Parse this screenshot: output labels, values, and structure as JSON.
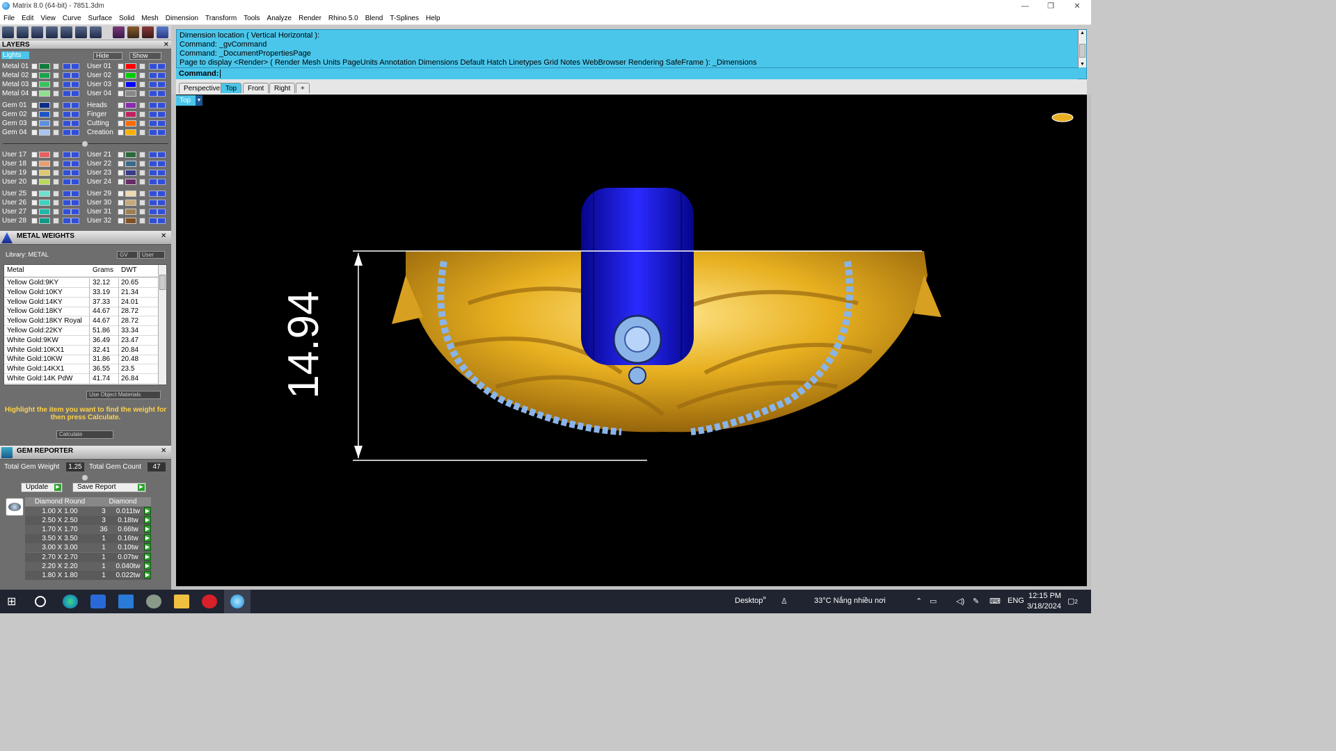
{
  "window": {
    "title": "Matrix 8.0 (64-bit) - 7851.3dm",
    "min": "—",
    "restore": "❐",
    "close": "✕"
  },
  "menu": [
    "File",
    "Edit",
    "View",
    "Curve",
    "Surface",
    "Solid",
    "Mesh",
    "Dimension",
    "Transform",
    "Tools",
    "Analyze",
    "Render",
    "Rhino 5.0",
    "Blend",
    "T-Splines",
    "Help"
  ],
  "layers": {
    "title": "LAYERS",
    "lights_label": "Lights",
    "hide_label": "Hide",
    "show_label": "Show",
    "left": [
      {
        "name": "Metal 01",
        "color": "#0f7a3a"
      },
      {
        "name": "Metal 02",
        "color": "#1aa34a"
      },
      {
        "name": "Metal 03",
        "color": "#39c35c"
      },
      {
        "name": "Metal 04",
        "color": "#8ee08e"
      },
      {
        "name": "Gem 01",
        "color": "#0a2c8c"
      },
      {
        "name": "Gem 02",
        "color": "#1c55c8"
      },
      {
        "name": "Gem 03",
        "color": "#5a8fe0"
      },
      {
        "name": "Gem 04",
        "color": "#a8c4f0"
      },
      {
        "name": "User 17",
        "color": "#e86060"
      },
      {
        "name": "User 18",
        "color": "#e8a070"
      },
      {
        "name": "User 19",
        "color": "#e0c870"
      },
      {
        "name": "User 20",
        "color": "#b8d860"
      },
      {
        "name": "User 25",
        "color": "#70e0d0"
      },
      {
        "name": "User 26",
        "color": "#40d0c0"
      },
      {
        "name": "User 27",
        "color": "#20b8a8"
      },
      {
        "name": "User 28",
        "color": "#109888"
      }
    ],
    "right": [
      {
        "name": "User 01",
        "color": "#ff0000"
      },
      {
        "name": "User 02",
        "color": "#00cc00"
      },
      {
        "name": "User 03",
        "color": "#0000ff"
      },
      {
        "name": "User 04",
        "color": "#888888"
      },
      {
        "name": "Heads",
        "color": "#8a2ab0"
      },
      {
        "name": "Finger",
        "color": "#c02060"
      },
      {
        "name": "Cutting",
        "color": "#ff6a00"
      },
      {
        "name": "Creation",
        "color": "#ffb000"
      },
      {
        "name": "User 21",
        "color": "#2a6a3a"
      },
      {
        "name": "User 22",
        "color": "#3a6a8a"
      },
      {
        "name": "User 23",
        "color": "#3a3a8a"
      },
      {
        "name": "User 24",
        "color": "#6a2a6a"
      },
      {
        "name": "User 29",
        "color": "#f0d8b0"
      },
      {
        "name": "User 30",
        "color": "#c8a878"
      },
      {
        "name": "User 31",
        "color": "#a08050"
      },
      {
        "name": "User 32",
        "color": "#805020"
      }
    ]
  },
  "metal_weights": {
    "title": "METAL WEIGHTS",
    "library": "Library: METAL",
    "gv_label": "GV",
    "user_label": "User",
    "headers": [
      "Metal",
      "Grams",
      "DWT"
    ],
    "rows": [
      [
        "Yellow Gold:9KY",
        "32.12",
        "20.65"
      ],
      [
        "Yellow Gold:10KY",
        "33.19",
        "21.34"
      ],
      [
        "Yellow Gold:14KY",
        "37.33",
        "24.01"
      ],
      [
        "Yellow Gold:18KY",
        "44.67",
        "28.72"
      ],
      [
        "Yellow Gold:18KY Royal",
        "44.67",
        "28.72"
      ],
      [
        "Yellow Gold:22KY",
        "51.86",
        "33.34"
      ],
      [
        "White Gold:9KW",
        "36.49",
        "23.47"
      ],
      [
        "White Gold:10KX1",
        "32.41",
        "20.84"
      ],
      [
        "White Gold:10KW",
        "31.86",
        "20.48"
      ],
      [
        "White Gold:14KX1",
        "36.55",
        "23.5"
      ],
      [
        "White Gold:14K PdW",
        "41.74",
        "26.84"
      ]
    ],
    "use_object_materials": "Use Object Materials",
    "hint": "Highlight the item you want to find the weight for then press Calculate.",
    "calculate": "Calculate"
  },
  "gem_reporter": {
    "title": "GEM REPORTER",
    "total_weight_label": "Total Gem Weight",
    "total_weight": "1.25",
    "total_count_label": "Total Gem Count",
    "total_count": "47",
    "update": "Update",
    "save_report": "Save Report",
    "headers": [
      "Diamond Round",
      "Diamond"
    ],
    "rows": [
      [
        "1.00 X 1.00",
        "3",
        "0.011tw"
      ],
      [
        "2.50 X 2.50",
        "3",
        "0.18tw"
      ],
      [
        "1.70 X 1.70",
        "36",
        "0.66tw"
      ],
      [
        "3.50 X 3.50",
        "1",
        "0.16tw"
      ],
      [
        "3.00 X 3.00",
        "1",
        "0.10tw"
      ],
      [
        "2.70 X 2.70",
        "1",
        "0.07tw"
      ],
      [
        "2.20 X 2.20",
        "1",
        "0.040tw"
      ],
      [
        "1.80 X 1.80",
        "1",
        "0.022tw"
      ]
    ]
  },
  "command": {
    "lines": [
      "Dimension location ( Vertical  Horizontal ):",
      "Command: _gvCommand",
      "Command: _DocumentPropertiesPage",
      "Page to display <Render> ( Render  Mesh  Units  PageUnits  Annotation  Dimensions  Default  Hatch  Linetypes  Grid  Notes  WebBrowser  Rendering  SafeFrame ): _Dimensions"
    ],
    "prompt": "Command:"
  },
  "viewport": {
    "tabs": [
      "Perspective",
      "Top",
      "Front",
      "Right"
    ],
    "active_tab": "Top",
    "add_tab": "+",
    "label": "Top",
    "dimension": "14.94",
    "metal_color": "#e8b020",
    "shank_color": "#1414d8",
    "gem_color": "#8ab4e8"
  },
  "taskbar": {
    "desktop": "Desktop",
    "weather": "33°C  Nắng nhiều nơi",
    "lang": "ENG",
    "time": "12:15 PM",
    "date": "3/18/2024",
    "notif": "2"
  }
}
